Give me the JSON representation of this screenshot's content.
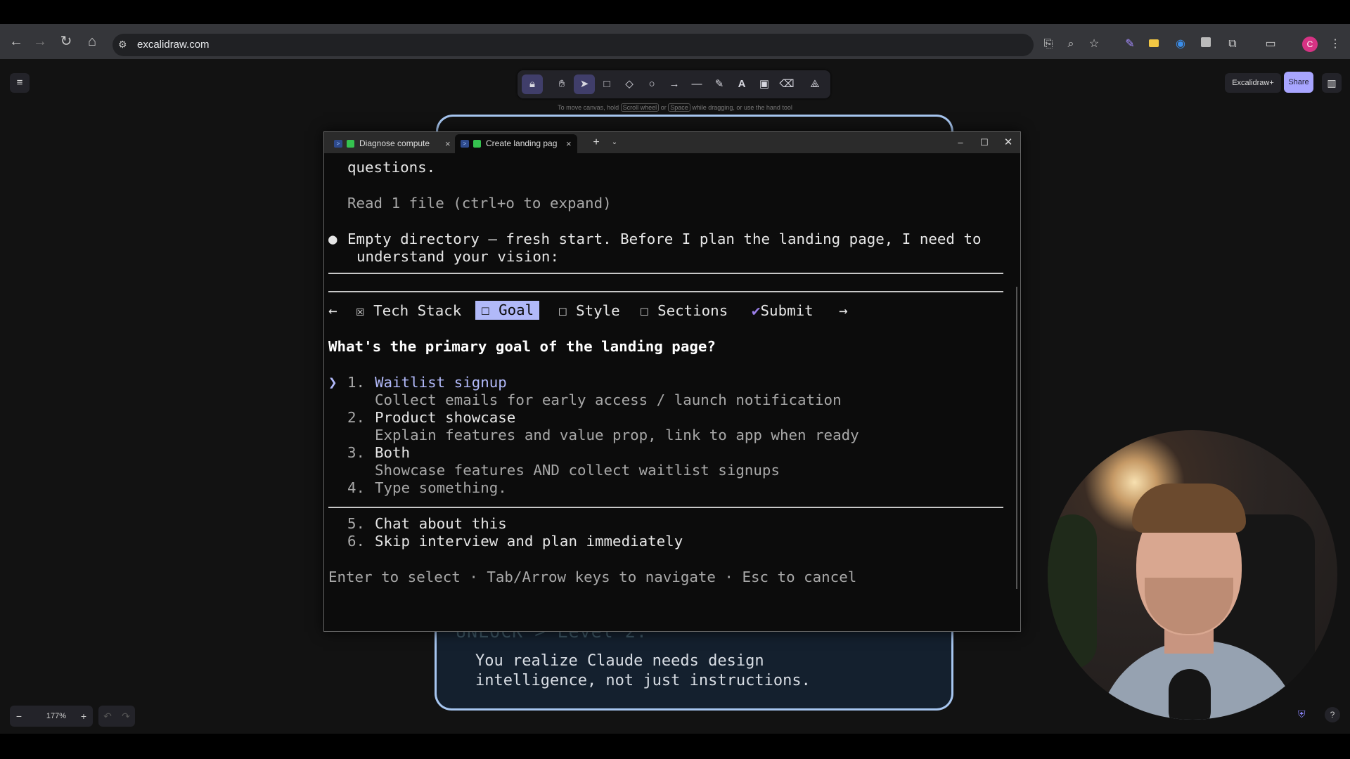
{
  "browser": {
    "url": "excalidraw.com",
    "avatar_letter": "C"
  },
  "excalidraw": {
    "hint": {
      "before_scroll": "To move canvas, hold",
      "scroll_key": "Scroll wheel",
      "or": "or",
      "space_key": "Space",
      "after": "while dragging, or use the hand tool"
    },
    "library_button": "Excalidraw+",
    "share_button": "Share",
    "zoom_level": "177%",
    "card": {
      "partial_heading": "UNLOCK > Level 2:",
      "line1": "You realize Claude needs design",
      "line2": "intelligence, not just instructions."
    }
  },
  "terminal": {
    "tabs": [
      {
        "title": "Diagnose compute"
      },
      {
        "title": "Create landing pag"
      }
    ],
    "lines": {
      "questions": "questions.",
      "read_file": "Read 1 file (ctrl+o to expand)",
      "bullet": "●",
      "intro1": "Empty directory — fresh start. Before I plan the landing page, I need to",
      "intro2": "understand your vision:"
    },
    "question_tabs": {
      "left_arrow": "←",
      "right_arrow": "→",
      "items": [
        {
          "mark": "☒",
          "label": "Tech Stack"
        },
        {
          "mark": "☐",
          "label": "Goal"
        },
        {
          "mark": "☐",
          "label": "Style"
        },
        {
          "mark": "☐",
          "label": "Sections"
        },
        {
          "mark": "✔",
          "label": "Submit"
        }
      ]
    },
    "question": "What's the primary goal of the landing page?",
    "cursor": "❯",
    "options": [
      {
        "num": "1.",
        "label": "Waitlist signup",
        "desc": "Collect emails for early access / launch notification"
      },
      {
        "num": "2.",
        "label": "Product showcase",
        "desc": "Explain features and value prop, link to app when ready"
      },
      {
        "num": "3.",
        "label": "Both",
        "desc": "Showcase features AND collect waitlist signups"
      },
      {
        "num": "4.",
        "label": "Type something."
      }
    ],
    "extra_options": [
      {
        "num": "5.",
        "label": "Chat about this"
      },
      {
        "num": "6.",
        "label": "Skip interview and plan immediately"
      }
    ],
    "footer": "Enter to select · Tab/Arrow keys to navigate · Esc to cancel"
  }
}
